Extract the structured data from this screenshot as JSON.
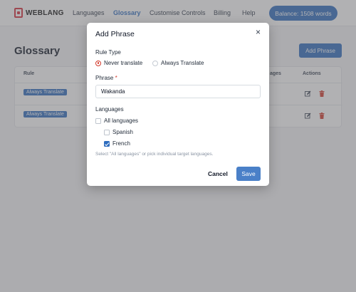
{
  "nav": {
    "brand": "WEBLANG",
    "links": [
      "Languages",
      "Glossary",
      "Customise Controls",
      "Billing",
      "Help"
    ],
    "active": "Glossary",
    "balance": "Balance: 1508 words"
  },
  "page": {
    "title": "Glossary",
    "add_button": "Add Phrase"
  },
  "table": {
    "headers": {
      "rule": "Rule",
      "languages": "ages",
      "actions": "Actions"
    },
    "rows": [
      {
        "rule": "Always Translate"
      },
      {
        "rule": "Always Translate"
      }
    ]
  },
  "modal": {
    "title": "Add Phrase",
    "close": "×",
    "rule_type_label": "Rule Type",
    "rule_options": [
      "Never translate",
      "Always Translate"
    ],
    "rule_selected": "Never translate",
    "phrase_label": "Phrase",
    "required_mark": "*",
    "phrase_value": "Wakanda",
    "languages_label": "Languages",
    "language_options": [
      {
        "label": "All languages",
        "checked": false
      },
      {
        "label": "Spanish",
        "checked": false
      },
      {
        "label": "French",
        "checked": true
      }
    ],
    "hint": "Select \"All languages\" or pick individual target languages.",
    "cancel": "Cancel",
    "save": "Save"
  },
  "colors": {
    "accent": "#2e6dbf",
    "danger": "#d33a2c",
    "brand": "#d62d3b"
  }
}
